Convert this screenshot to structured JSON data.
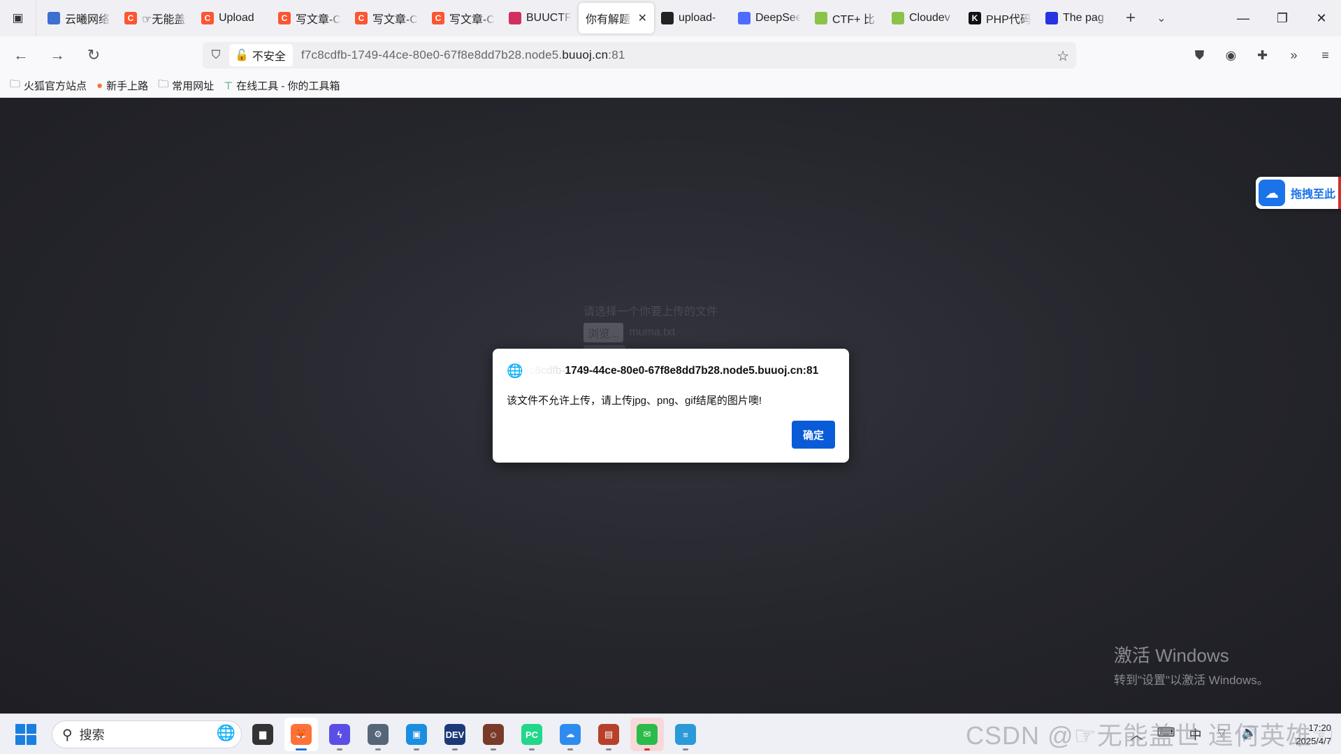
{
  "browser": {
    "tabs": [
      {
        "label": "云曦网络",
        "icon": "cloud-icon",
        "color": "#3b6fd0"
      },
      {
        "label": "☞无能盖世",
        "icon": "csdn-icon",
        "color": "#fc5531"
      },
      {
        "label": "Upload",
        "icon": "csdn-icon",
        "color": "#fc5531"
      },
      {
        "label": "写文章-CSDN",
        "icon": "csdn-icon",
        "color": "#fc5531"
      },
      {
        "label": "写文章-CSDN",
        "icon": "csdn-icon",
        "color": "#fc5531"
      },
      {
        "label": "写文章-CSDN",
        "icon": "csdn-icon",
        "color": "#fc5531"
      },
      {
        "label": "BUUCTF",
        "icon": "buuctf-icon",
        "color": "#d03060"
      },
      {
        "label": "你有解题",
        "icon": "none",
        "color": "#ffffff",
        "active": true
      },
      {
        "label": "upload-",
        "icon": "github-icon",
        "color": "#222222"
      },
      {
        "label": "DeepSeek",
        "icon": "deepseek-icon",
        "color": "#4d6bfe"
      },
      {
        "label": "CTF+ 比",
        "icon": "ctf-icon",
        "color": "#8bc34a"
      },
      {
        "label": "Cloudev",
        "icon": "ctf-icon",
        "color": "#8bc34a"
      },
      {
        "label": "PHP代码",
        "icon": "k-icon",
        "color": "#111111"
      },
      {
        "label": "The pag",
        "icon": "baidu-icon",
        "color": "#2932e1"
      }
    ],
    "insecure_label": "不安全",
    "url_prefix": "f7c8cdfb-1749-44ce-80e0-67f8e8dd7b28.node5.",
    "url_host": "buuoj.cn",
    "url_suffix": ":81",
    "bookmarks": [
      {
        "label": "火狐官方站点",
        "icon": "folder-icon"
      },
      {
        "label": "新手上路",
        "icon": "firefox-icon"
      },
      {
        "label": "常用网址",
        "icon": "folder-icon"
      },
      {
        "label": "在线工具 - 你的工具箱",
        "icon": "tool-icon"
      }
    ]
  },
  "page": {
    "bg_form_title": "请选择一个你要上传的文件",
    "bg_browse_label": "浏览...",
    "bg_file_name": "muma.txt",
    "drag_float_label": "拖拽至此",
    "activate_title": "激活 Windows",
    "activate_sub": "转到\"设置\"以激活 Windows。"
  },
  "dialog": {
    "url_faded": "c8cdfb-",
    "url_main": "1749-44ce-80e0-67f8e8dd7b28.node5.buuoj.cn:81",
    "message": "该文件不允许上传，请上传jpg、png、gif结尾的图片噢!",
    "ok_label": "确定"
  },
  "taskbar": {
    "search_placeholder": "搜索",
    "apps": [
      {
        "name": "task-view",
        "color": "#333333",
        "glyph": "▆"
      },
      {
        "name": "firefox",
        "color": "#ff7139",
        "glyph": "🦊",
        "selected": true
      },
      {
        "name": "app-bolt",
        "color": "#5b4ee6",
        "glyph": "ϟ"
      },
      {
        "name": "app-gear",
        "color": "#556677",
        "glyph": "⚙"
      },
      {
        "name": "vmware",
        "color": "#1a8fe0",
        "glyph": "▣"
      },
      {
        "name": "dev-cpp",
        "color": "#1c3a78",
        "glyph": "DEV"
      },
      {
        "name": "app-avatar",
        "color": "#7a3a2a",
        "glyph": "☺"
      },
      {
        "name": "pycharm",
        "color": "#21d789",
        "glyph": "PC"
      },
      {
        "name": "baidu-netdisk",
        "color": "#2e8cf0",
        "glyph": "☁"
      },
      {
        "name": "winrar",
        "color": "#b8402a",
        "glyph": "▤"
      },
      {
        "name": "wechat",
        "color": "#2bbb4a",
        "glyph": "✉",
        "active": true
      },
      {
        "name": "notepad",
        "color": "#2a9ad8",
        "glyph": "≡"
      }
    ],
    "tray_input": "中",
    "time": "17:20",
    "date": "2025/4/7",
    "watermark": "CSDN @☞无能盖世 逞何英雄☜"
  }
}
